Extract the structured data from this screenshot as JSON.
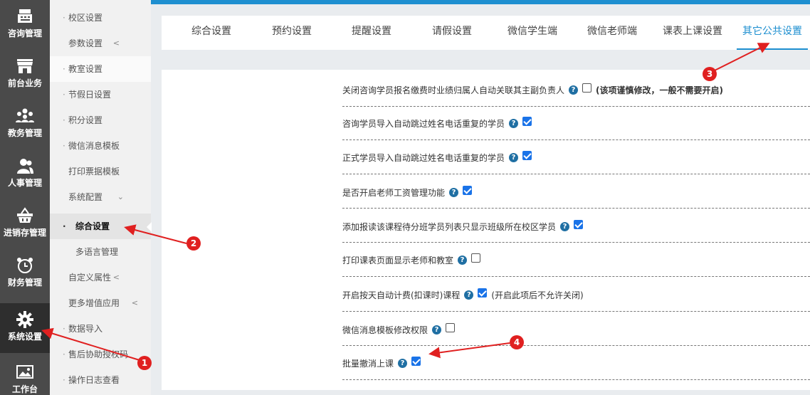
{
  "rail": [
    {
      "label": "咨询管理",
      "icon": "register-icon"
    },
    {
      "label": "前台业务",
      "icon": "storefront-icon"
    },
    {
      "label": "教务管理",
      "icon": "group-icon"
    },
    {
      "label": "人事管理",
      "icon": "people-icon"
    },
    {
      "label": "进销存管理",
      "icon": "basket-icon"
    },
    {
      "label": "财务管理",
      "icon": "alarm-clock-icon"
    },
    {
      "label": "系统设置",
      "icon": "gear-icon"
    },
    {
      "label": "工作台",
      "icon": "picture-icon"
    }
  ],
  "submenu": [
    {
      "label": "校区设置"
    },
    {
      "label": "参数设置"
    },
    {
      "label": "教室设置"
    },
    {
      "label": "节假日设置"
    },
    {
      "label": "积分设置"
    },
    {
      "label": "微信消息模板"
    },
    {
      "label": "打印票据模板"
    },
    {
      "label": "系统配置"
    },
    {
      "label": "综合设置"
    },
    {
      "label": "多语言管理"
    },
    {
      "label": "自定义属性"
    },
    {
      "label": "更多增值应用"
    },
    {
      "label": "数据导入"
    },
    {
      "label": "售后协助授权码"
    },
    {
      "label": "操作日志查看"
    }
  ],
  "tabs": [
    {
      "label": "综合设置"
    },
    {
      "label": "预约设置"
    },
    {
      "label": "提醒设置"
    },
    {
      "label": "请假设置"
    },
    {
      "label": "微信学生端"
    },
    {
      "label": "微信老师端"
    },
    {
      "label": "课表上课设置"
    },
    {
      "label": "其它公共设置"
    }
  ],
  "settings": [
    {
      "label": "关闭咨询学员报名缴费时业绩归属人自动关联其主副负责人",
      "checked": false,
      "note": "(该项谨慎修改，一般不需要开启)"
    },
    {
      "label": "咨询学员导入自动跳过姓名电话重复的学员",
      "checked": true,
      "note": ""
    },
    {
      "label": "正式学员导入自动跳过姓名电话重复的学员",
      "checked": true,
      "note": ""
    },
    {
      "label": "是否开启老师工资管理功能",
      "checked": true,
      "note": ""
    },
    {
      "label": "添加报读该课程待分班学员列表只显示班级所在校区学员",
      "checked": true,
      "note": ""
    },
    {
      "label": "打印课表页面显示老师和教室",
      "checked": false,
      "note": ""
    },
    {
      "label": "开启按天自动计费(扣课时)课程",
      "checked": true,
      "note": "(开启此项后不允许关闭)"
    },
    {
      "label": "微信消息模板修改权限",
      "checked": false,
      "note": ""
    },
    {
      "label": "批量撤消上课",
      "checked": true,
      "note": ""
    }
  ],
  "help_glyph": "?",
  "annotations": [
    "1",
    "2",
    "3",
    "4"
  ],
  "colors": {
    "accent": "#1e8fd0",
    "annotation": "#e02020",
    "checkbox": "#1a73e8"
  }
}
